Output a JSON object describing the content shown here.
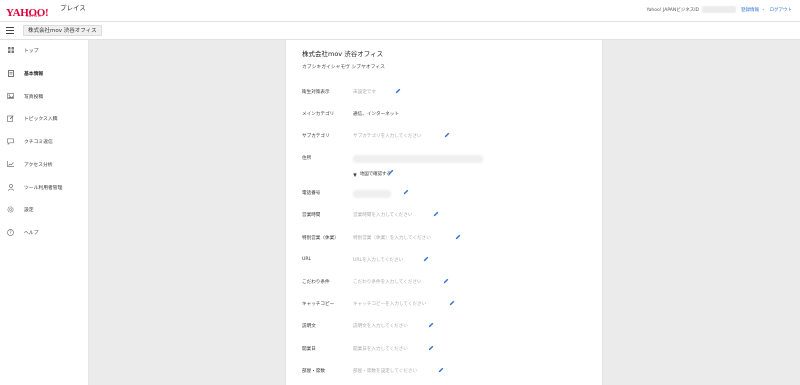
{
  "header": {
    "logo_text": "YAHOO!",
    "logo_sub": "JAPAN",
    "service_name": "プレイス",
    "business_id_label": "Yahoo! JAPANビジネスID",
    "register_info_link": "登録情報",
    "separator": "・",
    "logout_link": "ログアウト"
  },
  "subheader": {
    "shop_name": "株式会社mov 渋谷オフィス"
  },
  "sidebar": {
    "items": [
      {
        "label": "トップ",
        "icon": "grid-icon"
      },
      {
        "label": "基本情報",
        "icon": "document-icon",
        "active": true
      },
      {
        "label": "写真投稿",
        "icon": "photo-icon"
      },
      {
        "label": "トピックス入稿",
        "icon": "edit-icon"
      },
      {
        "label": "クチコミ返信",
        "icon": "comment-icon"
      },
      {
        "label": "アクセス分析",
        "icon": "chart-icon"
      },
      {
        "label": "ツール利用者管理",
        "icon": "person-icon"
      },
      {
        "label": "設定",
        "icon": "gear-icon"
      },
      {
        "label": "ヘルプ",
        "icon": "help-icon"
      }
    ]
  },
  "main": {
    "business_name": "株式会社mov 渋谷オフィス",
    "business_kana": "カブシキガイシャモヴ シブヤオフィス",
    "fields": {
      "covid": {
        "label": "衛生対策表示",
        "value": "未設定です"
      },
      "main_category": {
        "label": "メインカテゴリ",
        "value": "通信、インターネット"
      },
      "sub_category": {
        "label": "サブカテゴリ",
        "value": "サブカテゴリを入力してください"
      },
      "address": {
        "label": "住所",
        "map_link": "地図で確認する"
      },
      "phone": {
        "label": "電話番号"
      },
      "hours": {
        "label": "営業時間",
        "value": "営業時間を入力してください"
      },
      "special_hours": {
        "label": "特別営業（休業）",
        "value": "特別営業（休業）を入力してください"
      },
      "url": {
        "label": "URL",
        "value": "URLを入力してください"
      },
      "features": {
        "label": "こだわり条件",
        "value": "こだわり条件を入力してください"
      },
      "catchcopy": {
        "label": "キャッチコピー",
        "value": "キャッチコピーを入力してください"
      },
      "description": {
        "label": "説明文",
        "value": "説明文を入力してください"
      },
      "opening_date": {
        "label": "開業日",
        "value": "開業日を入力してください"
      },
      "last": {
        "label": "部屋・席数",
        "value": "部屋・席数を設定してください"
      }
    }
  },
  "colors": {
    "accent": "#2f6fd6",
    "brand": "#e1003a"
  }
}
